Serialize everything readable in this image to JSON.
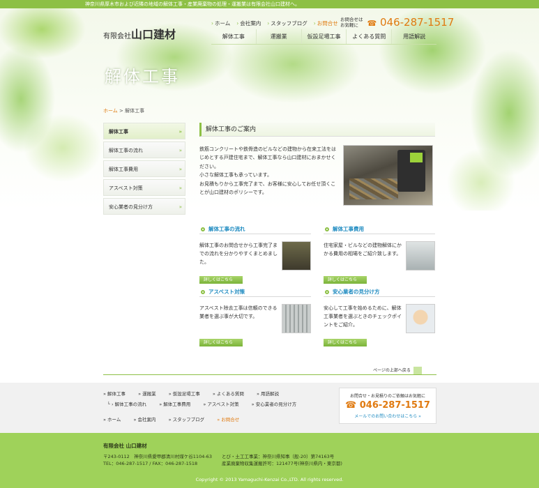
{
  "topbar": "神奈川県厚木市および近隣の地域の解体工事・産業廃棄物の処理・運搬業は有限会社山口建材へ。",
  "logo": {
    "prefix": "有限会社",
    "name": "山口建材"
  },
  "topnav": [
    {
      "label": "ホーム"
    },
    {
      "label": "会社案内"
    },
    {
      "label": "スタッフブログ"
    },
    {
      "label": "お問合せ"
    }
  ],
  "tel_header": {
    "note_line1": "お問合せは",
    "note_line2": "お気軽に",
    "number": "046-287-1517"
  },
  "mainnav": [
    "解体工事",
    "運搬業",
    "仮設足場工事",
    "よくある質問",
    "用語解説"
  ],
  "page_title": "解体工事",
  "breadcrumb": {
    "home": "ホーム",
    "sep": ">",
    "current": "解体工事"
  },
  "sidebar": [
    "解体工事",
    "解体工事の流れ",
    "解体工事費用",
    "アスベスト対策",
    "安心業者の見分け方"
  ],
  "main": {
    "heading": "解体工事のご案内",
    "paragraphs": [
      "鉄筋コンクリートや鉄骨造のビルなどの建物から在来工法をはじめとする戸建住宅まで、解体工事なら山口建材におまかせください。",
      "小さな解体工事も承っています。",
      "お見積もりから工事完了まで、お客様に安心してお任せ頂くことが山口建材のポリシーです。"
    ]
  },
  "cards": [
    {
      "title": "解体工事の流れ",
      "text": "解体工事のお問合せから工事完了までの流れを分かりやすくまとめました。",
      "button": "詳しくはこちら"
    },
    {
      "title": "解体工事費用",
      "text": "住宅家屋・ビルなどの建物解体にかかる費用の相場をご紹介致します。",
      "button": "詳しくはこちら"
    },
    {
      "title": "アスベスト対策",
      "text": "アスベスト除去工事は信頼のできる業者を選ぶ事が大切です。",
      "button": "詳しくはこちら"
    },
    {
      "title": "安心業者の見分け方",
      "text": "安心して工事を始めるために、解体工事業者を選ぶときのチェックポイントをご紹介。",
      "button": "詳しくはこちら"
    }
  ],
  "pagetop": "ページの上部へ戻る",
  "footer_nav": {
    "row1": [
      "解体工事",
      "運搬業",
      "仮設足場工事",
      "よくある質問",
      "用語解説"
    ],
    "row2": [
      "解体工事の流れ",
      "解体工事費用",
      "アスベスト対策",
      "安心業者の見分け方"
    ],
    "row3": [
      "ホーム",
      "会社案内",
      "スタッフブログ",
      "お問合せ"
    ]
  },
  "footer_contact": {
    "note": "お問合せ・お見積りのご依頼はお気軽に",
    "number": "046-287-1517",
    "link": "メールでのお問い合わせはこちら »"
  },
  "company": {
    "name": "有限会社 山口建材",
    "address": "〒243-0112　神奈川県愛甲郡清川村煤ケ谷1104-63",
    "tel_fax": "TEL：046-287-1517 / FAX：046-287-1518",
    "license1": "とび・土工工事業：神奈川県知事（般-20）第74163号",
    "license2": "産業廃棄物収集運搬許可：121477号(神奈川県内・東京都)"
  },
  "copyright": "Copyright © 2013 Yamaguchi-Kenzai Co.,LTD. All rights reserved.",
  "colors": {
    "accent": "#8dc045",
    "orange": "#e07a10",
    "blue": "#1d8ac0"
  }
}
